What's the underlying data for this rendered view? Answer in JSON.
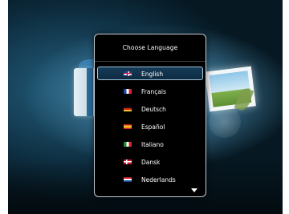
{
  "dialog": {
    "title": "Choose Language",
    "selected_index": 0,
    "languages": [
      {
        "label": "English",
        "flag": "uk-flag-icon"
      },
      {
        "label": "Français",
        "flag": "france-flag-icon"
      },
      {
        "label": "Deutsch",
        "flag": "germany-flag-icon"
      },
      {
        "label": "Español",
        "flag": "spain-flag-icon"
      },
      {
        "label": "Italiano",
        "flag": "italy-flag-icon"
      },
      {
        "label": "Dansk",
        "flag": "denmark-flag-icon"
      },
      {
        "label": "Nederlands",
        "flag": "netherlands-flag-icon"
      }
    ],
    "scroll_icon": "scroll-down-arrow-icon"
  },
  "colors": {
    "dialog_bg": "#000000",
    "selection_border": "#9ec3dc",
    "text": "#ffffff"
  }
}
